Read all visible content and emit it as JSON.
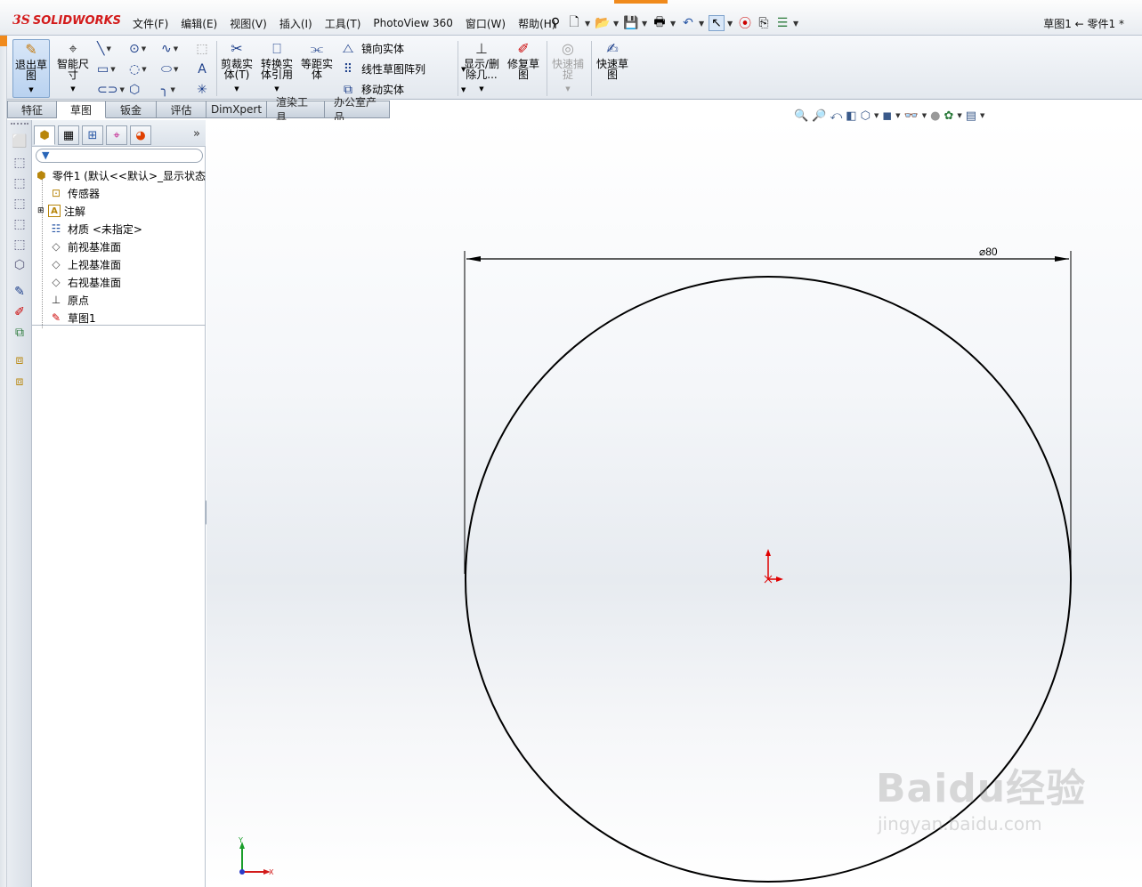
{
  "app": {
    "logo_ds": "3S",
    "logo_text": "SOLIDWORKS",
    "doc_title": "草图1 ← 零件1 *"
  },
  "menu": [
    "文件(F)",
    "编辑(E)",
    "视图(V)",
    "插入(I)",
    "工具(T)",
    "PhotoView 360",
    "窗口(W)",
    "帮助(H)"
  ],
  "quick_access": [
    "pin-icon",
    "new-document-icon",
    "open-icon",
    "save-icon",
    "print-icon",
    "undo-icon",
    "select-icon",
    "traffic-light-icon",
    "options-icon",
    "customize-icon"
  ],
  "commands": {
    "exit_sketch": "退出草图",
    "smart_dim": "智能尺寸",
    "trim": "剪裁实体(T)",
    "convert": "转换实体引用",
    "offset": "等距实体",
    "mirror": "镜向实体",
    "linear_pattern": "线性草图阵列",
    "move": "移动实体",
    "show_delete": "显示/删除几...",
    "repair": "修复草图",
    "quick_snap": "快速捕捉",
    "rapid_sketch": "快速草图"
  },
  "tabs": [
    {
      "label": "特征",
      "active": false
    },
    {
      "label": "草图",
      "active": true
    },
    {
      "label": "钣金",
      "active": false
    },
    {
      "label": "评估",
      "active": false
    },
    {
      "label": "DimXpert",
      "active": false
    },
    {
      "label": "渲染工具",
      "active": false
    },
    {
      "label": "办公室产品",
      "active": false
    }
  ],
  "feature_tree": {
    "root": "零件1 (默认<<默认>_显示状态",
    "items": [
      "传感器",
      "注解",
      "材质 <未指定>",
      "前视基准面",
      "上视基准面",
      "右视基准面",
      "原点",
      "草图1"
    ]
  },
  "drawing": {
    "dimension_label": "⌀80",
    "diameter": 80
  },
  "watermark": {
    "main": "Baidu经验",
    "sub": "jingyan.baidu.com"
  },
  "axes": {
    "x": "X",
    "y": "Y"
  },
  "colors": {
    "accent": "#f08a1c",
    "brand_red": "#d31b1b",
    "origin_red": "#e00000"
  }
}
